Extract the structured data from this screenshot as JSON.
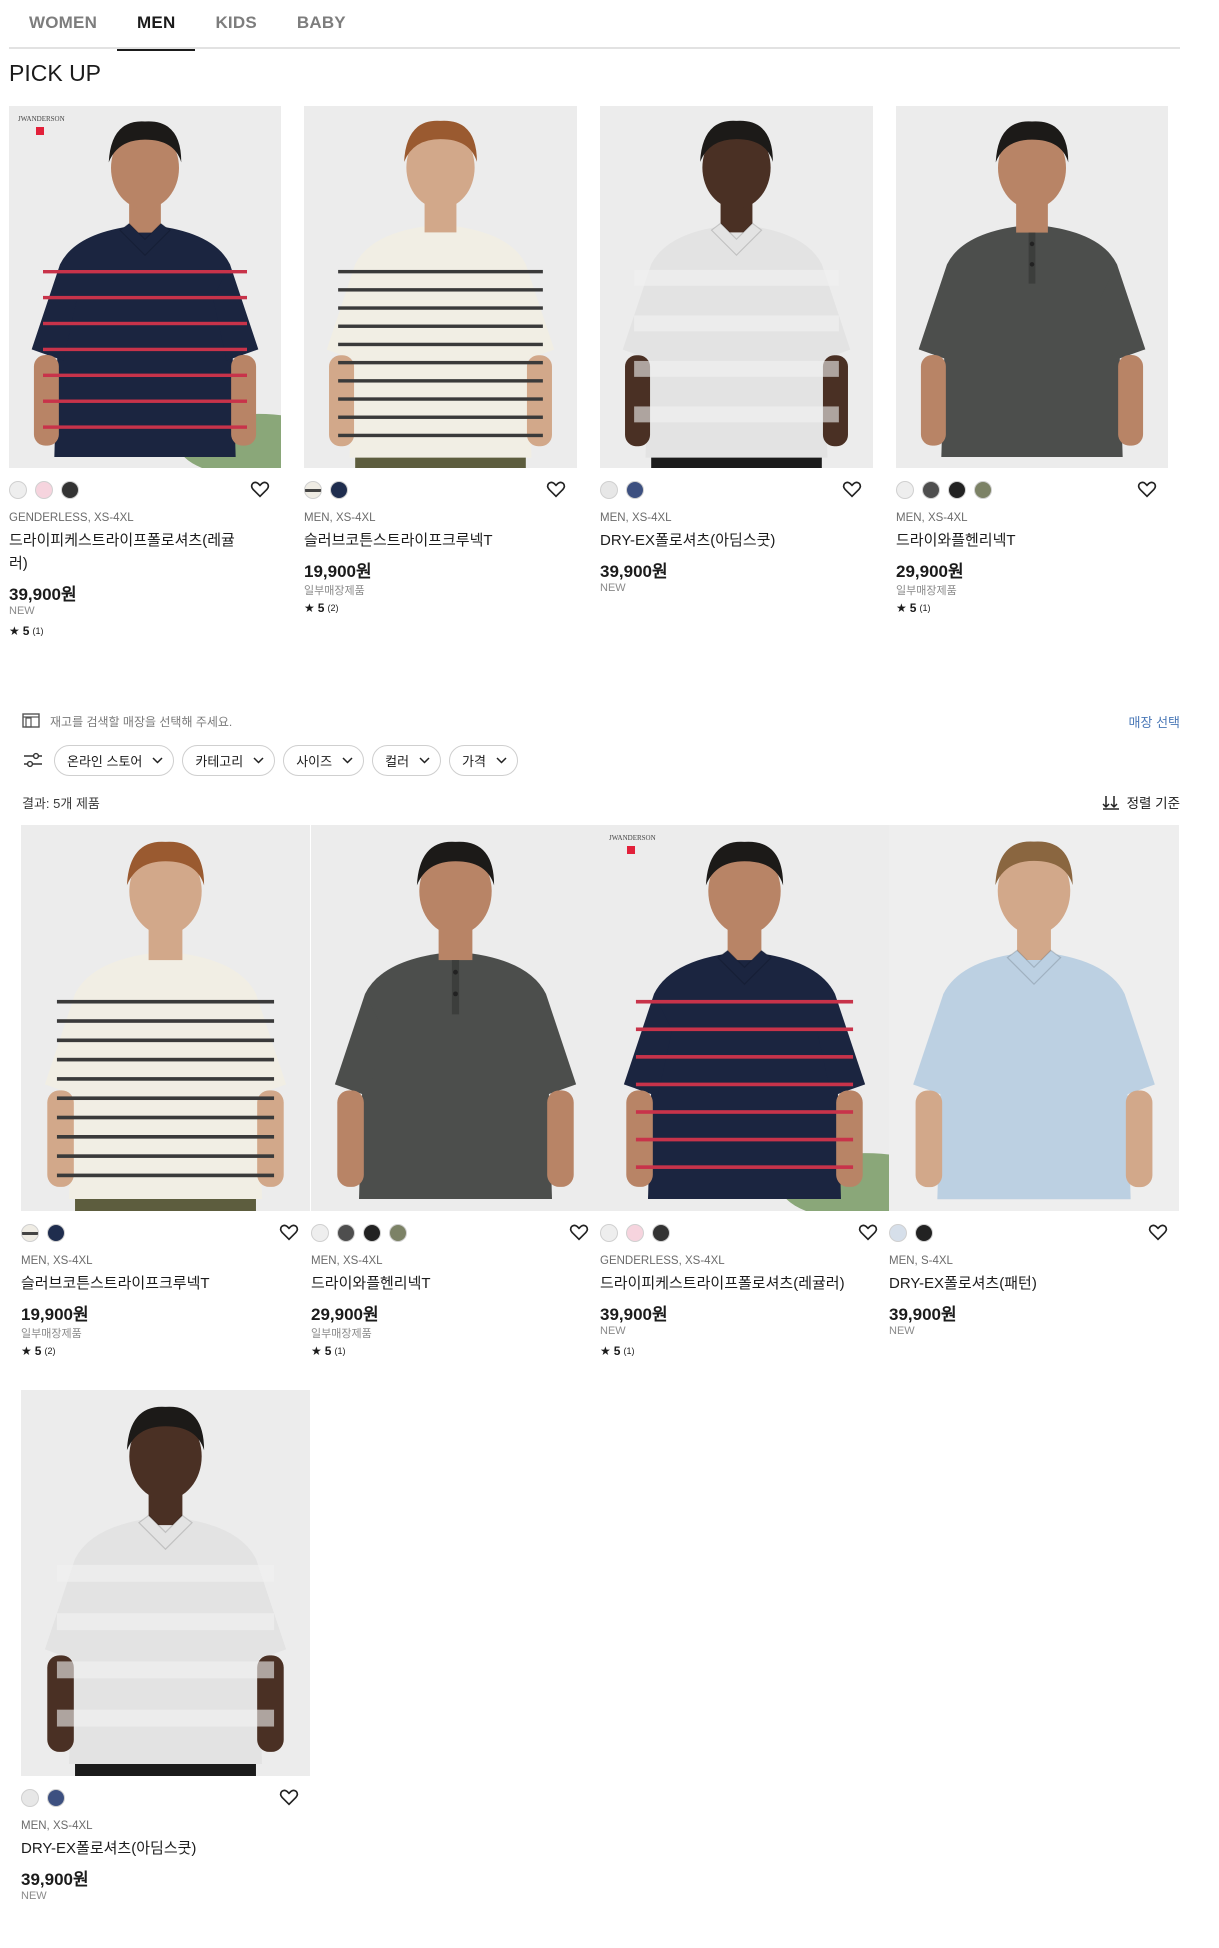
{
  "gender_tabs": [
    "WOMEN",
    "MEN",
    "KIDS",
    "BABY"
  ],
  "active_tab": "MEN",
  "section_title": "PICK UP",
  "pickup": [
    {
      "brand_mark": "JWANDERSON",
      "swatches": [
        "#eeeeee",
        "#f6d4de",
        "#333333"
      ],
      "meta": "GENDERLESS, XS-4XL",
      "name_line1": "드라이피케스트라이프폴로셔츠(레귤",
      "name_line2": "러)",
      "price": "39,900원",
      "flag": "NEW",
      "rating": "5",
      "review_count": "(1)"
    },
    {
      "swatches": [
        "#efece4",
        "#1f2d4e"
      ],
      "meta": "MEN, XS-4XL",
      "name_line1": "슬러브코튼스트라이프크루넥T",
      "name_line2": "",
      "price": "19,900원",
      "flag": "일부매장제품",
      "rating": "5",
      "review_count": "(2)"
    },
    {
      "swatches": [
        "#e7e7e7",
        "#3d5080"
      ],
      "meta": "MEN, XS-4XL",
      "name_line1": "DRY-EX폴로셔츠(아딤스쿳)",
      "name_line2": "",
      "price": "39,900원",
      "flag": "NEW",
      "rating": "",
      "review_count": ""
    },
    {
      "swatches": [
        "#eeeeee",
        "#4e4e4e",
        "#222222",
        "#7c8266"
      ],
      "meta": "MEN, XS-4XL",
      "name_line1": "드라이와플헨리넥T",
      "name_line2": "",
      "price": "29,900원",
      "flag": "일부매장제품",
      "rating": "5",
      "review_count": "(1)"
    }
  ],
  "store": {
    "text": "재고를 검색할 매장을 선택해 주세요.",
    "link": "매장 선택"
  },
  "filters": [
    "온라인 스토어",
    "카테고리",
    "사이즈",
    "컬러",
    "가격"
  ],
  "result_count": "결과: 5개 제품",
  "sort_label": "정렬 기준",
  "results": [
    {
      "swatches": [
        "#efece4",
        "#1f2d4e"
      ],
      "meta": "MEN, XS-4XL",
      "name_line1": "슬러브코튼스트라이프크루넥T",
      "price": "19,900원",
      "flag": "일부매장제품",
      "rating": "5",
      "review_count": "(2)"
    },
    {
      "swatches": [
        "#eeeeee",
        "#4e4e4e",
        "#222222",
        "#7c8266"
      ],
      "meta": "MEN, XS-4XL",
      "name_line1": "드라이와플헨리넥T",
      "price": "29,900원",
      "flag": "일부매장제품",
      "rating": "5",
      "review_count": "(1)"
    },
    {
      "brand_mark": "JWANDERSON",
      "swatches": [
        "#eeeeee",
        "#f6d4de",
        "#333333"
      ],
      "meta": "GENDERLESS, XS-4XL",
      "name_line1": "드라이피케스트라이프폴로셔츠(레귤러)",
      "price": "39,900원",
      "flag": "NEW",
      "rating": "5",
      "review_count": "(1)"
    },
    {
      "swatches": [
        "#d6dfea",
        "#222222"
      ],
      "meta": "MEN, S-4XL",
      "name_line1": "DRY-EX폴로셔츠(패턴)",
      "price": "39,900원",
      "flag": "NEW",
      "rating": "",
      "review_count": ""
    },
    {
      "swatches": [
        "#e7e7e7",
        "#3d5080"
      ],
      "meta": "MEN, XS-4XL",
      "name_line1": "DRY-EX폴로셔츠(아딤스쿳)",
      "price": "39,900원",
      "flag": "NEW",
      "rating": "",
      "review_count": ""
    }
  ]
}
